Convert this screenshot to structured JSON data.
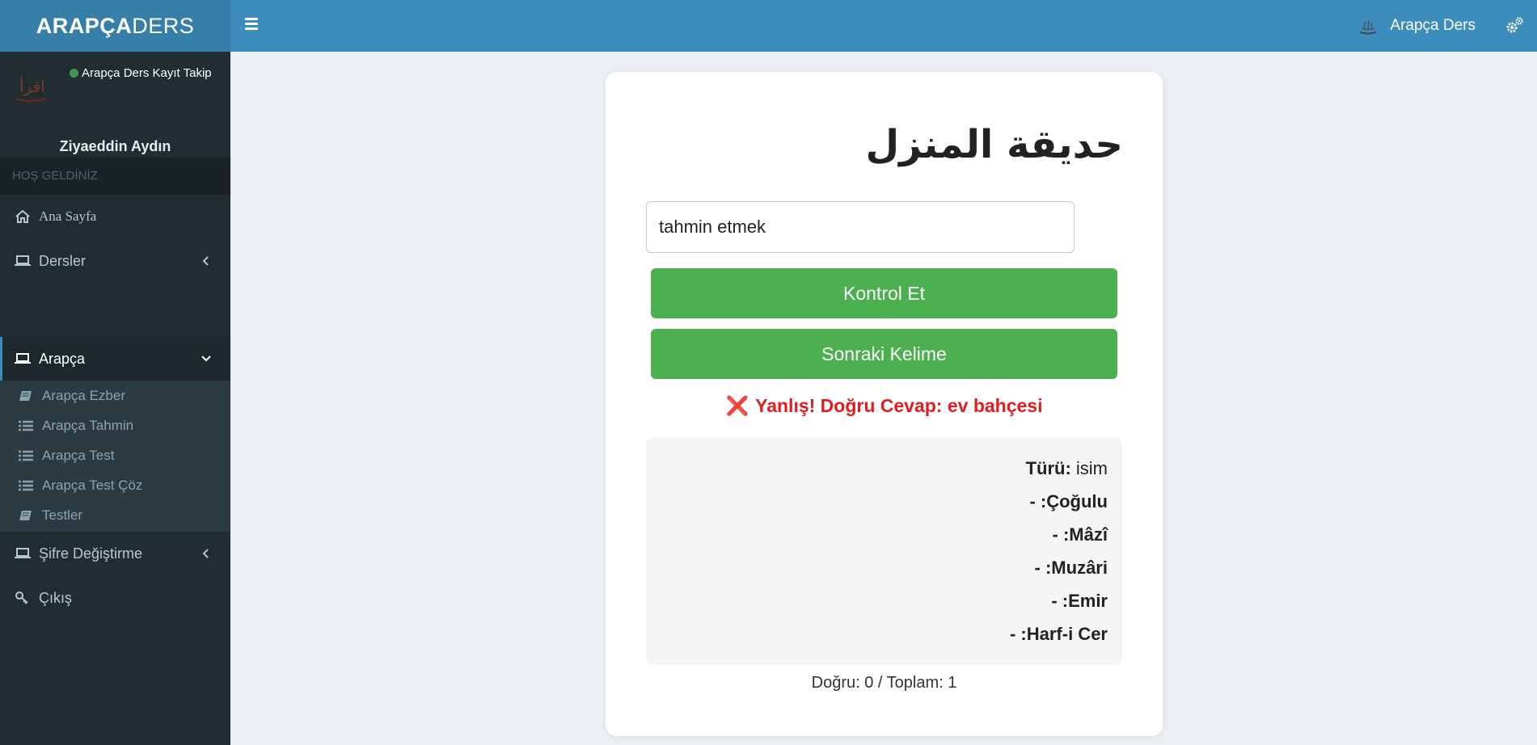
{
  "brand": {
    "bold": "ARAPÇA",
    "light": "DERS"
  },
  "navbar": {
    "user_label": "Arapça Ders"
  },
  "sidebar": {
    "status": "Arapça Ders Kayıt Takip",
    "user_name": "Ziyaeddin Aydın",
    "section_header": "HOŞ GELDİNİZ",
    "items": [
      {
        "label": "Ana Sayfa",
        "icon": "home-icon"
      },
      {
        "label": "Dersler",
        "icon": "laptop-icon"
      },
      {
        "label": "Arapça",
        "icon": "laptop-icon"
      },
      {
        "label": "Şifre Değiştirme",
        "icon": "laptop-icon"
      },
      {
        "label": "Çıkış",
        "icon": "key-icon"
      }
    ],
    "sub_items": [
      {
        "label": "Arapça Ezber",
        "icon": "book-icon"
      },
      {
        "label": "Arapça Tahmin",
        "icon": "list-icon"
      },
      {
        "label": "Arapça Test",
        "icon": "list-icon"
      },
      {
        "label": "Arapça Test Çöz",
        "icon": "list-icon"
      },
      {
        "label": "Testler",
        "icon": "book-icon"
      }
    ]
  },
  "quiz": {
    "word": "حديقة المنزل",
    "input_value": "tahmin etmek",
    "check_label": "Kontrol Et",
    "next_label": "Sonraki Kelime",
    "result_icon": "❌",
    "result_text": "Yanlış! Doğru Cevap: ev bahçesi",
    "info": {
      "turu_label": "Türü:",
      "turu_value": "isim",
      "rows": [
        "- :Çoğulu",
        "- :Mâzî",
        "- :Muzâri",
        "- :Emir",
        "- :Harf-i Cer"
      ]
    },
    "score": "Doğru: 0 / Toplam: 1"
  },
  "colors": {
    "header": "#3c8dbc",
    "logo_bg": "#367fa9",
    "sidebar": "#222d32",
    "button": "#4caf50",
    "error": "#e11d1d"
  }
}
